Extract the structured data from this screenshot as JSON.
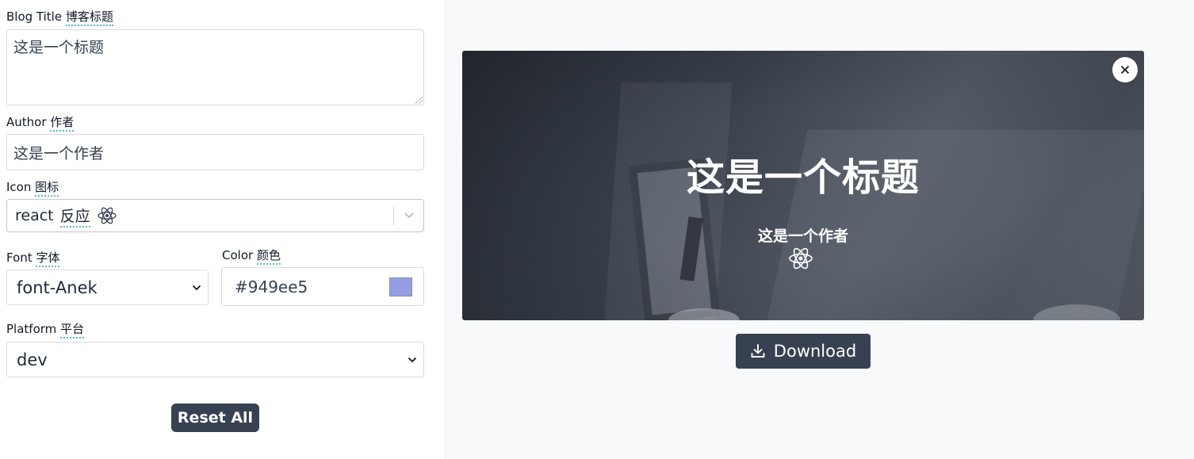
{
  "form": {
    "title": {
      "label": "Blog Title",
      "label_zh": "博客标题",
      "value": "这是一个标题"
    },
    "author": {
      "label": "Author",
      "label_zh": "作者",
      "value": "这是一个作者"
    },
    "icon": {
      "label": "Icon",
      "label_zh": "图标",
      "value": "react",
      "value_zh": "反应",
      "icon": "react-icon"
    },
    "font": {
      "label": "Font",
      "label_zh": "字体",
      "value": "font-Anek"
    },
    "color": {
      "label": "Color",
      "label_zh": "颜色",
      "value": "#949ee5"
    },
    "platform": {
      "label": "Platform",
      "label_zh": "平台",
      "value": "dev"
    },
    "reset_label": "Reset All"
  },
  "preview": {
    "title": "这是一个标题",
    "author": "这是一个作者",
    "icon": "react-icon",
    "download_label": "Download"
  },
  "colors": {
    "accent_underline": "#5fb8c2",
    "button_bg": "#374151",
    "swatch": "#949ee5",
    "preview_bg": "#f8f9fb"
  }
}
